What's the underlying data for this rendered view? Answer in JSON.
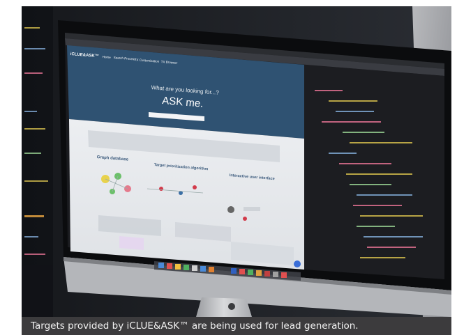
{
  "photo": {
    "description_icon": "photo-of-imac-showing-iclue-ask-website",
    "screen": {
      "brand": "iCLUE&ASK™",
      "nav_items": [
        "Home",
        "Search Process",
        "TX Customization",
        "TX Browser"
      ],
      "hero_question": "What are you looking for...?",
      "hero_title": "ASK me.",
      "features": [
        "Graph database",
        "Target prioritization algorithm",
        "Interactive user interface"
      ]
    }
  },
  "caption": {
    "text": "Targets provided by iCLUE&ASK™ are being used for lead generation."
  },
  "colors": {
    "caption_bg": "#3c3b3d",
    "hero_bg": "#2f5272",
    "code_bg": "#1c1d21"
  }
}
